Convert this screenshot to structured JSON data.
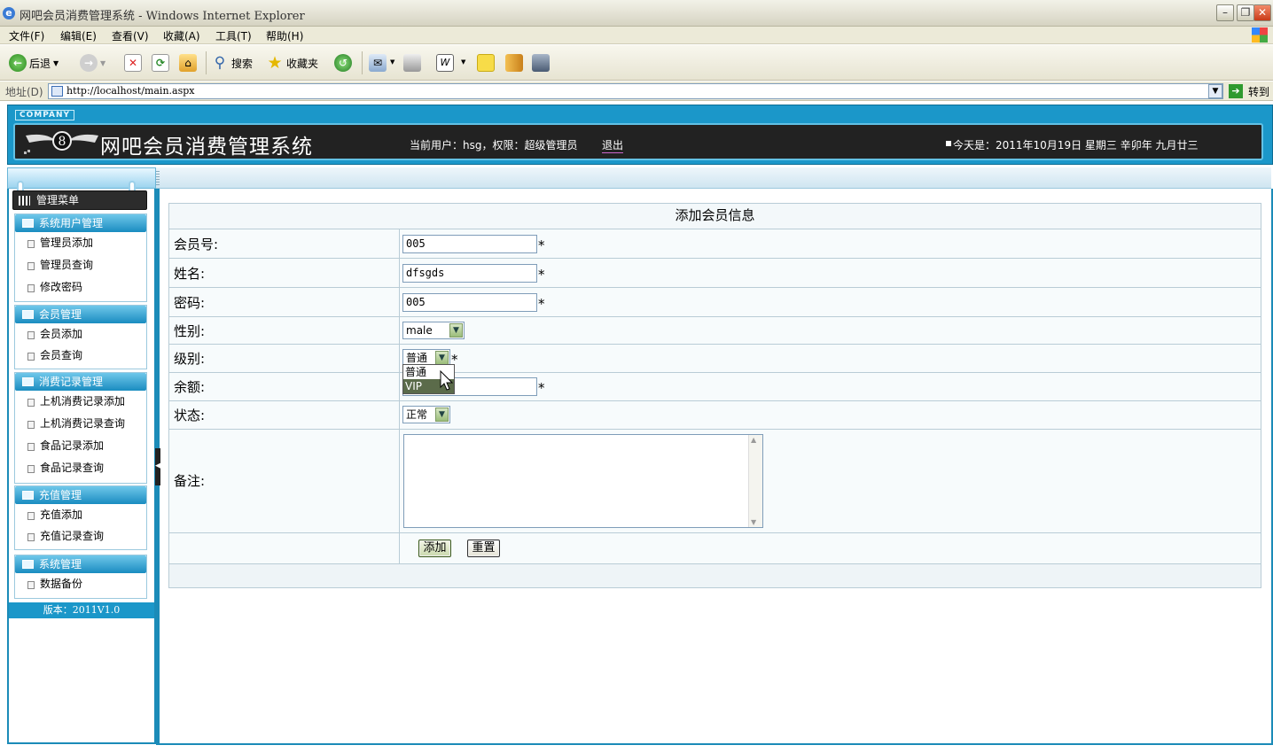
{
  "window": {
    "title": "网吧会员消费管理系统 - Windows Internet Explorer"
  },
  "menubar": [
    "文件(F)",
    "编辑(E)",
    "查看(V)",
    "收藏(A)",
    "工具(T)",
    "帮助(H)"
  ],
  "toolbar": {
    "back": "后退",
    "search": "搜索",
    "favorites": "收藏夹"
  },
  "address": {
    "label": "地址(D)",
    "url": "http://localhost/main.aspx",
    "go": "转到"
  },
  "header": {
    "company": "COMPANY",
    "title": "网吧会员消费管理系统",
    "user_info": "当前用户：hsg，权限：超级管理员",
    "logout": "退出",
    "today": "今天是：2011年10月19日 星期三 辛卯年 九月廿三"
  },
  "sidebar": {
    "heading": "管理菜单",
    "groups": [
      {
        "title": "系统用户管理",
        "items": [
          "管理员添加",
          "管理员查询",
          "修改密码"
        ]
      },
      {
        "title": "会员管理",
        "items": [
          "会员添加",
          "会员查询"
        ]
      },
      {
        "title": "消费记录管理",
        "items": [
          "上机消费记录添加",
          "上机消费记录查询",
          "食品记录添加",
          "食品记录查询"
        ]
      },
      {
        "title": "充值管理",
        "items": [
          "充值添加",
          "充值记录查询"
        ]
      },
      {
        "title": "系统管理",
        "items": [
          "数据备份"
        ]
      }
    ],
    "version": "版本：2011V1.0"
  },
  "form": {
    "title": "添加会员信息",
    "member_no": {
      "label": "会员号:",
      "value": "005"
    },
    "name": {
      "label": "姓名:",
      "value": "dfsgds"
    },
    "password": {
      "label": "密码:",
      "value": "005"
    },
    "gender": {
      "label": "性别:",
      "value": "male"
    },
    "level": {
      "label": "级别:",
      "value": "普通",
      "options": [
        "普通",
        "VIP"
      ]
    },
    "balance": {
      "label": "余额:",
      "value": ""
    },
    "status": {
      "label": "状态:",
      "value": "正常"
    },
    "remark": {
      "label": "备注:",
      "value": ""
    },
    "required_mark": "*",
    "add_button": "添加",
    "reset_button": "重置"
  }
}
